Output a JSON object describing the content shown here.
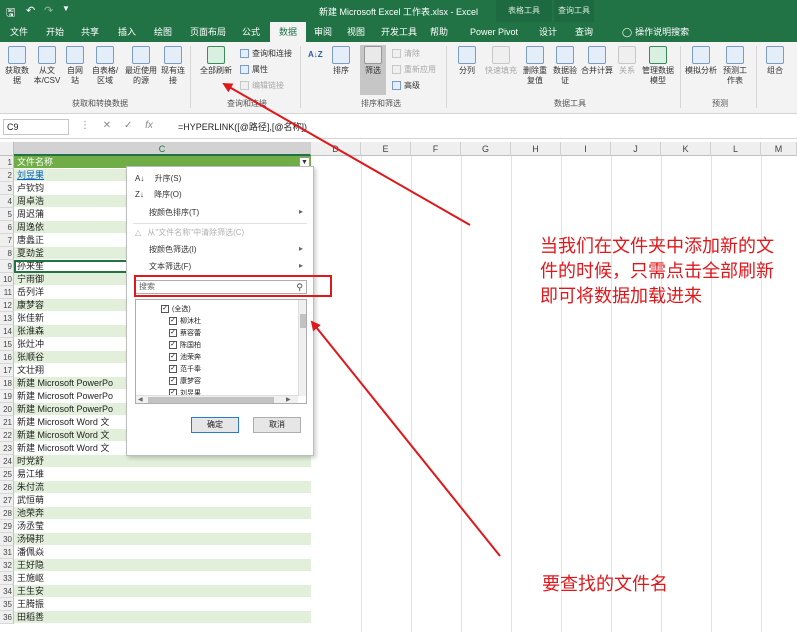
{
  "window": {
    "title": "新建 Microsoft Excel 工作表.xlsx  -  Excel",
    "context_tab_1": "表格工具",
    "context_tab_2": "查询工具"
  },
  "tabs": [
    {
      "label": "文件"
    },
    {
      "label": "开始"
    },
    {
      "label": "共享"
    },
    {
      "label": "插入"
    },
    {
      "label": "绘图"
    },
    {
      "label": "页面布局"
    },
    {
      "label": "公式"
    },
    {
      "label": "数据"
    },
    {
      "label": "审阅"
    },
    {
      "label": "视图"
    },
    {
      "label": "开发工具"
    },
    {
      "label": "帮助"
    },
    {
      "label": "Power Pivot"
    },
    {
      "label": "设计"
    },
    {
      "label": "查询"
    }
  ],
  "tell_me": "操作说明搜索",
  "ribbon": {
    "get_data": "获取数据",
    "from_csv": "从文本/CSV",
    "from_web": "自网站",
    "from_table": "自表格/区域",
    "recent_sources": "最近使用的源",
    "existing_conn": "现有连接",
    "group_get_transform": "获取和转换数据",
    "refresh_all": "全部刷新",
    "queries_conn": "查询和连接",
    "properties": "属性",
    "edit_links": "编辑链接",
    "group_queries": "查询和连接",
    "sort_az": "A↓Z",
    "sort": "排序",
    "filter": "筛选",
    "clear": "清除",
    "reapply": "重新应用",
    "advanced": "高级",
    "group_sort_filter": "排序和筛选",
    "split": "分列",
    "flash_fill": "快速填充",
    "remove_dup": "删除重复值",
    "validation": "数据验证",
    "consolidate": "合并计算",
    "relationships": "关系",
    "data_model": "管理数据模型",
    "group_data_tools": "数据工具",
    "what_if": "模拟分析",
    "forecast_sheet": "预测工作表",
    "group_forecast": "预测",
    "outline": "组合"
  },
  "formula_bar": {
    "name_box": "C9",
    "formula": "=HYPERLINK([@路径],[@名称])"
  },
  "columns": [
    "C",
    "D",
    "E",
    "F",
    "G",
    "H",
    "I",
    "J",
    "K",
    "L",
    "M"
  ],
  "rows": [
    {
      "n": "1",
      "v": "文件名称"
    },
    {
      "n": "2",
      "v": "刘昱果"
    },
    {
      "n": "3",
      "v": "卢钦钧"
    },
    {
      "n": "4",
      "v": "周卓浩"
    },
    {
      "n": "5",
      "v": "周迟蒲"
    },
    {
      "n": "6",
      "v": "周逸依"
    },
    {
      "n": "7",
      "v": "唐蠡正"
    },
    {
      "n": "8",
      "v": "夏劲釜"
    },
    {
      "n": "9",
      "v": "孙来笙"
    },
    {
      "n": "10",
      "v": "宁雨御"
    },
    {
      "n": "11",
      "v": "岳列洋"
    },
    {
      "n": "12",
      "v": "康梦容"
    },
    {
      "n": "13",
      "v": "张佳新"
    },
    {
      "n": "14",
      "v": "张淮森"
    },
    {
      "n": "15",
      "v": "张灶冲"
    },
    {
      "n": "16",
      "v": "张顺谷"
    },
    {
      "n": "17",
      "v": "文壮翔"
    },
    {
      "n": "18",
      "v": "新建 Microsoft PowerPo"
    },
    {
      "n": "19",
      "v": "新建 Microsoft PowerPo"
    },
    {
      "n": "20",
      "v": "新建 Microsoft PowerPo"
    },
    {
      "n": "21",
      "v": "新建 Microsoft Word 文"
    },
    {
      "n": "22",
      "v": "新建 Microsoft Word 文"
    },
    {
      "n": "23",
      "v": "新建 Microsoft Word 文"
    },
    {
      "n": "24",
      "v": "时党舒"
    },
    {
      "n": "25",
      "v": "易江维"
    },
    {
      "n": "26",
      "v": "朱付流"
    },
    {
      "n": "27",
      "v": "武恒萌"
    },
    {
      "n": "28",
      "v": "池荣奔"
    },
    {
      "n": "29",
      "v": "汤丞莹"
    },
    {
      "n": "30",
      "v": "汤碍邦"
    },
    {
      "n": "31",
      "v": "潘佩焱"
    },
    {
      "n": "32",
      "v": "王好隐"
    },
    {
      "n": "33",
      "v": "王施岖"
    },
    {
      "n": "34",
      "v": "王生安"
    },
    {
      "n": "35",
      "v": "王腾振"
    },
    {
      "n": "36",
      "v": "田稻善"
    }
  ],
  "filter_menu": {
    "sort_asc": "升序(S)",
    "sort_desc": "降序(O)",
    "sort_by_color": "按颜色排序(T)",
    "clear_filter": "从\"文件名称\"中清除筛选(C)",
    "filter_by_color": "按颜色筛选(I)",
    "text_filters": "文本筛选(F)",
    "search_placeholder": "搜索",
    "items": [
      "(全选)",
      "柳沐杜",
      "蔡容蕾",
      "陈国柏",
      "池荣奔",
      "范千奉",
      "康梦容",
      "刘昱果"
    ],
    "ok": "确定",
    "cancel": "取消"
  },
  "annotations": {
    "refresh_note": "当我们在文件夹中添加新的文件的时候，只需点击全部刷新即可将数据加载进来",
    "search_note": "要查找的文件名"
  },
  "colors": {
    "excel_green": "#217346",
    "header_fill": "#70ad47",
    "band_fill": "#e2efda",
    "annotation_red": "#e0171b"
  }
}
